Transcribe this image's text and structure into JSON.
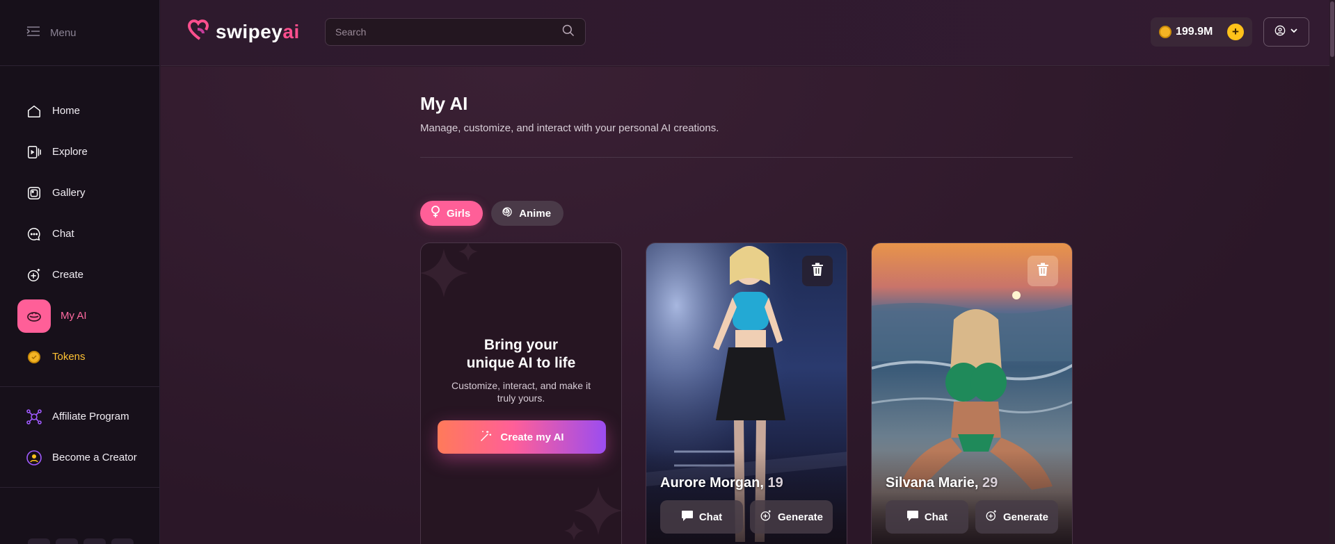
{
  "sidebar": {
    "menu_label": "Menu",
    "items": [
      {
        "label": "Home",
        "icon": "home-icon"
      },
      {
        "label": "Explore",
        "icon": "explore-icon"
      },
      {
        "label": "Gallery",
        "icon": "gallery-icon"
      },
      {
        "label": "Chat",
        "icon": "chat-icon"
      },
      {
        "label": "Create",
        "icon": "create-icon"
      },
      {
        "label": "My AI",
        "icon": "my-ai-icon",
        "active": true
      },
      {
        "label": "Tokens",
        "icon": "token-icon"
      }
    ],
    "secondary_items": [
      {
        "label": "Affiliate Program",
        "icon": "affiliate-icon"
      },
      {
        "label": "Become a Creator",
        "icon": "creator-icon"
      }
    ]
  },
  "header": {
    "logo_main": "swipey",
    "logo_accent": "ai",
    "search_placeholder": "Search",
    "balance": "199.9M"
  },
  "main": {
    "title": "My AI",
    "subtitle": "Manage, customize, and interact with your personal AI creations.",
    "tabs": [
      {
        "label": "Girls",
        "active": true
      },
      {
        "label": "Anime",
        "active": false
      }
    ],
    "create_card": {
      "title_line1": "Bring your",
      "title_line2": "unique AI to life",
      "subtitle": "Customize, interact, and make it truly yours.",
      "button": "Create my AI"
    },
    "characters": [
      {
        "name": "Aurore Morgan,",
        "age": "19",
        "chat": "Chat",
        "generate": "Generate"
      },
      {
        "name": "Silvana Marie,",
        "age": "29",
        "chat": "Chat",
        "generate": "Generate"
      }
    ]
  },
  "colors": {
    "accent": "#ff5f98",
    "tokens": "#ffc233",
    "sidebar_bg": "#17101a",
    "page_bg": "#2b1728"
  }
}
